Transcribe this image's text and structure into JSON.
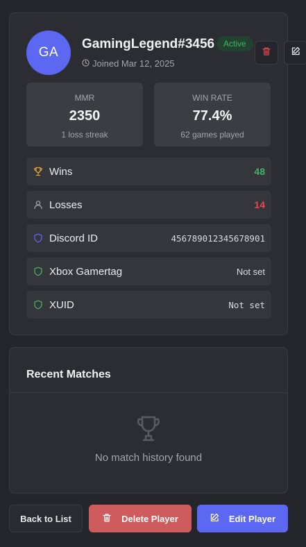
{
  "profile": {
    "initials": "GA",
    "username": "GamingLegend#3456",
    "status": "Active",
    "joined": "Joined Mar 12, 2025"
  },
  "stats": {
    "mmr": {
      "label": "MMR",
      "value": "2350",
      "sub": "1 loss streak"
    },
    "winrate": {
      "label": "WIN RATE",
      "value": "77.4%",
      "sub": "62 games played"
    }
  },
  "rows": [
    {
      "label": "Wins",
      "value": "48",
      "icon": "trophy-icon"
    },
    {
      "label": "Losses",
      "value": "14",
      "icon": "user-icon"
    },
    {
      "label": "Discord ID",
      "value": "456789012345678901",
      "icon": "shield-icon"
    },
    {
      "label": "Xbox Gamertag",
      "value": "Not set",
      "icon": "shield-icon"
    },
    {
      "label": "XUID",
      "value": "Not set",
      "icon": "shield-icon"
    }
  ],
  "matches": {
    "title": "Recent Matches",
    "empty": "No match history found"
  },
  "actions": {
    "back": "Back to List",
    "delete": "Delete Player",
    "edit": "Edit Player"
  },
  "colors": {
    "accent": "#5c67f2",
    "danger": "#cf5c5c",
    "success": "#3fb463",
    "loss": "#e5484d",
    "trophy": "#e8a33b"
  }
}
